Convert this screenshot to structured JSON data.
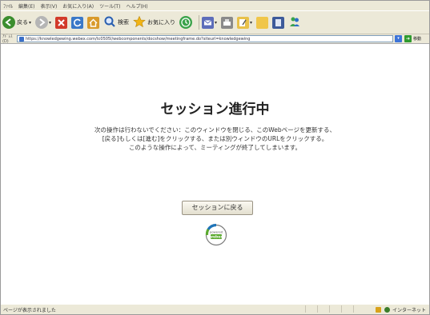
{
  "browser": {
    "menu": [
      "ﾌｧｲﾙ",
      "編集(E)",
      "表示(V)",
      "お気に入り(A)",
      "ツール(T)",
      "ヘルプ(H)"
    ],
    "toolbar": {
      "back_label": "戻る",
      "search_label": "検索",
      "favorites_label": "お気に入り"
    },
    "address_label": "ｱﾄﾞﾚｽ(D)",
    "url": "https://knowledgewing.webex.com/tc0505l/webcomponents/docshow/meetingframe.do?siteurl=knowledgewing",
    "go_label": "移動"
  },
  "page": {
    "title": "セッション進行中",
    "message_lines": [
      "次の操作は行わないでください：このウィンドウを閉じる、このWebページを更新する、",
      "[戻る]もしくは[進む]をクリックする、または別ウィンドウのURLをクリックする。",
      "このような操作によって、ミーティングが終了してしまいます。"
    ],
    "return_button": "セッションに戻る",
    "logo_text": "webex",
    "logo_subtext": "powered"
  },
  "statusbar": {
    "text": "ページが表示されました",
    "zone": "インターネット"
  },
  "colors": {
    "chrome": "#ece9d8",
    "back": "#3b8d2e",
    "forward": "#9a9a9a",
    "stop": "#d23a2a",
    "refresh": "#3a78c8",
    "home": "#d99a2b",
    "star": "#f2b414",
    "history": "#3aa24a",
    "mail": "#5d6dba",
    "print": "#777777",
    "edit": "#e8c14a",
    "misc": "#6a8f3a",
    "webex_blue": "#1f74b8",
    "webex_green": "#5aa92e"
  }
}
